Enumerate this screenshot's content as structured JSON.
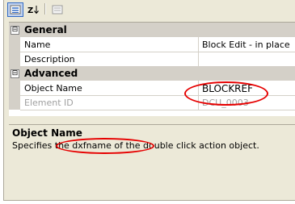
{
  "toolbar": {
    "buttons": [
      {
        "icon": "categorized-icon",
        "active": true
      },
      {
        "icon": "sort-alphabetical-icon",
        "active": false
      },
      {
        "icon": "property-pages-icon",
        "active": false
      }
    ]
  },
  "grid": {
    "general": {
      "label": "General",
      "toggle": "⊟",
      "rows": [
        {
          "name": "Name",
          "value": "Block Edit - in place"
        },
        {
          "name": "Description",
          "value": ""
        }
      ]
    },
    "advanced": {
      "label": "Advanced",
      "toggle": "⊟",
      "rows": [
        {
          "name": "Object Name",
          "value": "BLOCKREF"
        },
        {
          "name": "Element ID",
          "value": "DCU_0003"
        }
      ]
    }
  },
  "description": {
    "title": "Object Name",
    "text": "Specifies the dxfname of the double click action object."
  },
  "colors": {
    "highlight": "#e60000",
    "panel": "#ece9d8",
    "gutter": "#d4d0c8"
  }
}
